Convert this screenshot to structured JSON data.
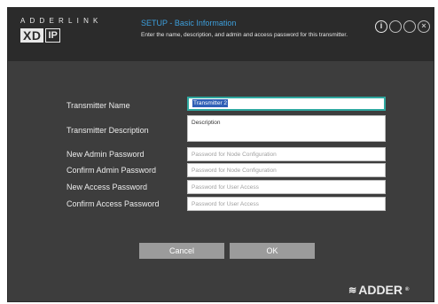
{
  "brand": {
    "top_text": "ADDERLINK",
    "logo_main": "XD",
    "logo_suffix": "IP"
  },
  "setup": {
    "title": "SETUP - Basic Information",
    "description": "Enter the name, description, and admin and access password for this transmitter."
  },
  "window_controls": [
    {
      "icon": "info-icon",
      "glyph": "i"
    },
    {
      "icon": "help-icon",
      "glyph": ""
    },
    {
      "icon": "refresh-icon",
      "glyph": ""
    },
    {
      "icon": "close-icon",
      "glyph": "×"
    }
  ],
  "form": {
    "transmitter_name": {
      "label": "Transmitter Name",
      "value": "Transmitter 2"
    },
    "transmitter_description": {
      "label": "Transmitter Description",
      "value": "Description"
    },
    "new_admin_password": {
      "label": "New Admin Password",
      "placeholder": "Password for Node Configuration"
    },
    "confirm_admin_password": {
      "label": "Confirm Admin Password",
      "placeholder": "Password for Node Configuration"
    },
    "new_access_password": {
      "label": "New Access Password",
      "placeholder": "Password for User Access"
    },
    "confirm_access_password": {
      "label": "Confirm Access Password",
      "placeholder": "Password for User Access"
    }
  },
  "buttons": {
    "cancel": "Cancel",
    "ok": "OK"
  },
  "footer": {
    "logo_text": "ADDER",
    "logo_mark": "≋",
    "registered": "®"
  },
  "colors": {
    "accent_blue": "#3d9fdc",
    "focus_teal": "#2fa8a0",
    "selection_blue": "#2f5fb6",
    "button_gray": "#9b9b9b",
    "panel_dark": "#3d3d3d"
  }
}
